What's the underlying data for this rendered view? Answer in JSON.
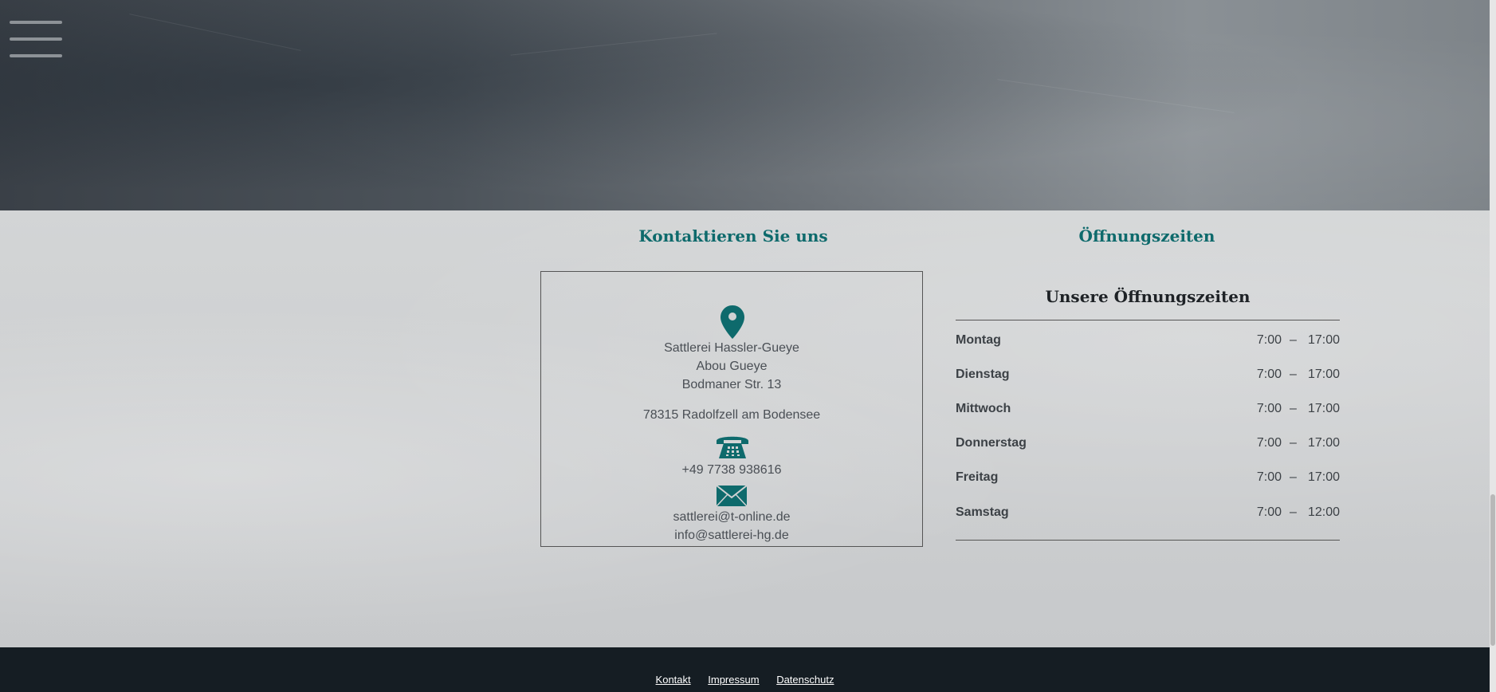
{
  "header": {
    "menu_icon": "hamburger-menu-icon"
  },
  "contact": {
    "title": "Kontaktieren Sie uns",
    "location_icon": "map-pin-icon",
    "name": "Sattlerei Hassler-Gueye",
    "person": "Abou Gueye",
    "street": "Bodmaner Str. 13",
    "city": "78315 Radolfzell am Bodensee",
    "phone_icon": "telephone-icon",
    "phone": "+49 7738 938616",
    "mail_icon": "envelope-icon",
    "email1": "sattlerei@t-online.de",
    "email2": "info@sattlerei-hg.de"
  },
  "hours": {
    "title": "Öffnungszeiten",
    "heading": "Unsere Öffnungszeiten",
    "separator": "–",
    "rows": [
      {
        "day": "Montag",
        "open": "7:00",
        "close": "17:00"
      },
      {
        "day": "Dienstag",
        "open": "7:00",
        "close": "17:00"
      },
      {
        "day": "Mittwoch",
        "open": "7:00",
        "close": "17:00"
      },
      {
        "day": "Donnerstag",
        "open": "7:00",
        "close": "17:00"
      },
      {
        "day": "Freitag",
        "open": "7:00",
        "close": "17:00"
      },
      {
        "day": "Samstag",
        "open": "7:00",
        "close": "12:00"
      }
    ]
  },
  "footer": {
    "links": [
      "Kontakt",
      "Impressum",
      "Datenschutz"
    ]
  },
  "colors": {
    "accent": "#0e6a6c",
    "footer_bg": "#151d23"
  }
}
